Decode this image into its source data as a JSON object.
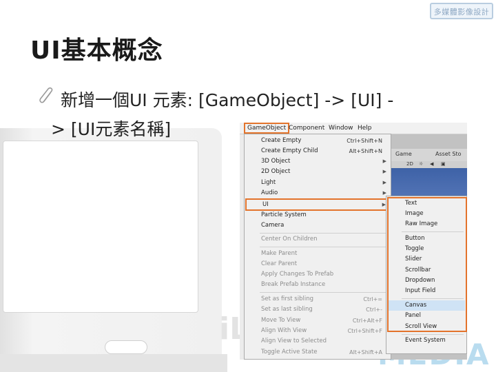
{
  "logo_text": "多媒體影像設計",
  "title": "UI基本概念",
  "bullet": {
    "line1": "新增一個UI 元素: [GameObject] -> [UI] -",
    "line2": "> [UI元素名稱]"
  },
  "watermark": {
    "left": "iL",
    "right": "MEDIA"
  },
  "unity": {
    "menubar": [
      "GameObject",
      "Component",
      "Window",
      "Help"
    ],
    "editor": {
      "tab_game": "Game",
      "tab_asset": "Asset Sto",
      "mode_2d": "2D"
    },
    "gameobject_menu": [
      {
        "label": "Create Empty",
        "shortcut": "Ctrl+Shift+N"
      },
      {
        "label": "Create Empty Child",
        "shortcut": "Alt+Shift+N"
      },
      {
        "label": "3D Object",
        "submenu": true
      },
      {
        "label": "2D Object",
        "submenu": true
      },
      {
        "label": "Light",
        "submenu": true
      },
      {
        "label": "Audio",
        "submenu": true
      },
      {
        "label": "UI",
        "submenu": true
      },
      {
        "label": "Particle System"
      },
      {
        "label": "Camera"
      },
      {
        "label": "Center On Children"
      },
      {
        "label": "Make Parent"
      },
      {
        "label": "Clear Parent"
      },
      {
        "label": "Apply Changes To Prefab"
      },
      {
        "label": "Break Prefab Instance"
      },
      {
        "label": "Set as first sibling",
        "shortcut": "Ctrl+="
      },
      {
        "label": "Set as last sibling",
        "shortcut": "Ctrl+-"
      },
      {
        "label": "Move To View",
        "shortcut": "Ctrl+Alt+F"
      },
      {
        "label": "Align With View",
        "shortcut": "Ctrl+Shift+F"
      },
      {
        "label": "Align View to Selected"
      },
      {
        "label": "Toggle Active State",
        "shortcut": "Alt+Shift+A"
      }
    ],
    "ui_submenu": [
      "Text",
      "Image",
      "Raw Image",
      "Button",
      "Toggle",
      "Slider",
      "Scrollbar",
      "Dropdown",
      "Input Field",
      "Canvas",
      "Panel",
      "Scroll View",
      "Event System"
    ]
  },
  "colors": {
    "highlight": "#e3732b",
    "selection": "#cfe3f5",
    "scene": "#4a6cb0"
  }
}
